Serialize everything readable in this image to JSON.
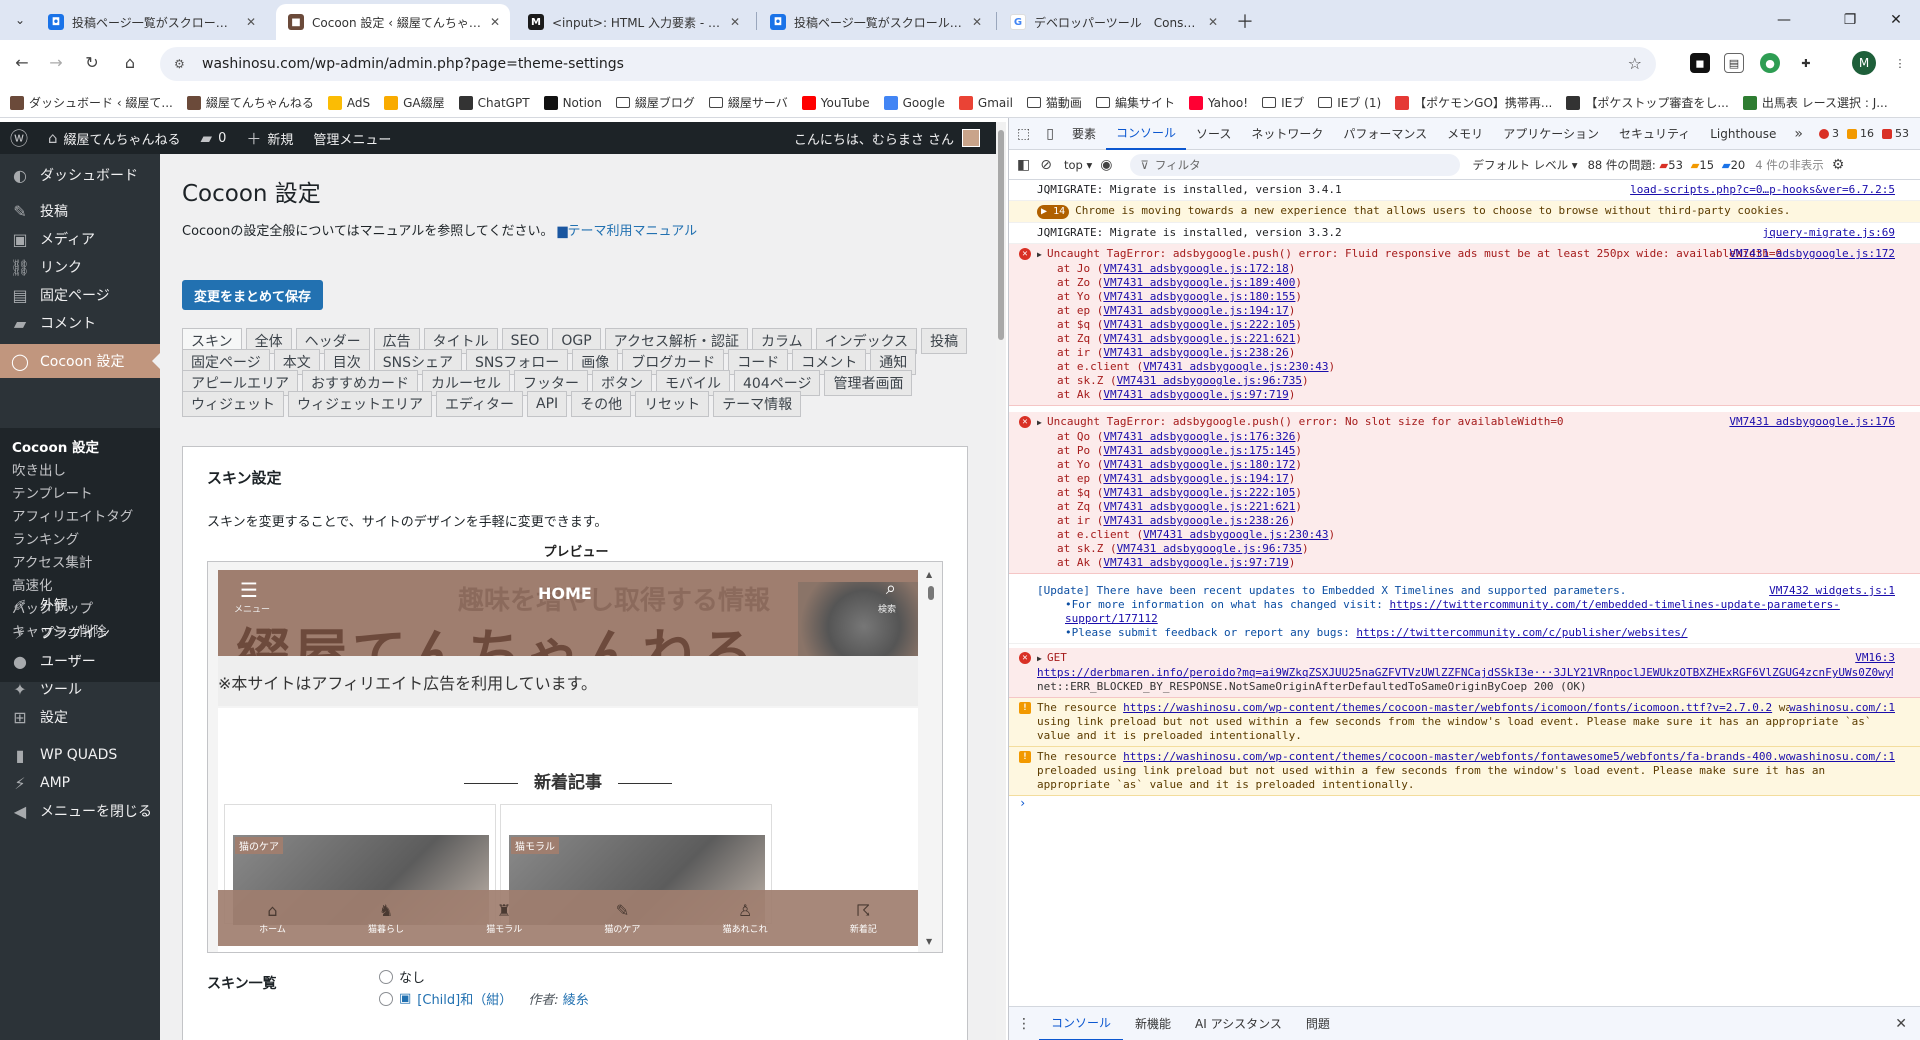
{
  "browser": {
    "tabs": [
      {
        "title": "投稿ページ一覧がスクロール出来な",
        "fav_color": "#1a73e8",
        "fav": "◘"
      },
      {
        "title": "Cocoon 設定 ‹ 綴屋てんちゃんねる",
        "fav_color": "#6b4a3a",
        "fav": "■"
      },
      {
        "title": "<input>: HTML 入力要素 - HTM",
        "fav_color": "#1b1b1b",
        "fav": "M"
      },
      {
        "title": "投稿ページ一覧がスクロール出来な",
        "fav_color": "#1a73e8",
        "fav": "◘"
      },
      {
        "title": "デベロッパーツール　Console - Goo",
        "fav_color": "#ffffff",
        "fav": "G"
      }
    ],
    "url": "washinosu.com/wp-admin/admin.php?page=theme-settings",
    "bookmarks": [
      {
        "label": "ダッシュボード ‹ 綴屋て...",
        "kind": "site",
        "color": "#6b4a3a"
      },
      {
        "label": "綴屋てんちゃんねる",
        "kind": "site",
        "color": "#6b4a3a"
      },
      {
        "label": "AdS",
        "kind": "site",
        "color": "#fbbc04"
      },
      {
        "label": "GA綴屋",
        "kind": "site",
        "color": "#f9ab00"
      },
      {
        "label": "ChatGPT",
        "kind": "site",
        "color": "#333333"
      },
      {
        "label": "Notion",
        "kind": "site",
        "color": "#111111"
      },
      {
        "label": "綴屋ブログ",
        "kind": "folder",
        "color": "#444444"
      },
      {
        "label": "綴屋サーバ",
        "kind": "folder",
        "color": "#444444"
      },
      {
        "label": "YouTube",
        "kind": "site",
        "color": "#ff0000"
      },
      {
        "label": "Google",
        "kind": "site",
        "color": "#4285f4"
      },
      {
        "label": "Gmail",
        "kind": "site",
        "color": "#ea4335"
      },
      {
        "label": "猫動画",
        "kind": "folder",
        "color": "#444444"
      },
      {
        "label": "編集サイト",
        "kind": "folder",
        "color": "#444444"
      },
      {
        "label": "Yahoo!",
        "kind": "site",
        "color": "#ff0033"
      },
      {
        "label": "IEブ",
        "kind": "folder",
        "color": "#444444"
      },
      {
        "label": "IEブ (1)",
        "kind": "folder",
        "color": "#444444"
      },
      {
        "label": "【ポケモンGO】携帯再...",
        "kind": "site",
        "color": "#e53935"
      },
      {
        "label": "【ポケストップ審査をし...",
        "kind": "site",
        "color": "#333333"
      },
      {
        "label": "出馬表 レース選択 : J...",
        "kind": "site",
        "color": "#2e7d32"
      }
    ],
    "profile_initial": "M"
  },
  "wp": {
    "adminbar": {
      "site_name": "綴屋てんちゃんねる",
      "comments_count": "0",
      "new_label": "新規",
      "admin_menu": "管理メニュー",
      "greeting": "こんにちは、むらまさ さん"
    },
    "sidebar": {
      "items": [
        {
          "label": "ダッシュボード",
          "icon": "dashboard-icon",
          "glyph": "◐"
        },
        {
          "label": "投稿",
          "icon": "pin-icon",
          "glyph": "✎"
        },
        {
          "label": "メディア",
          "icon": "media-icon",
          "glyph": "▣"
        },
        {
          "label": "リンク",
          "icon": "link-icon",
          "glyph": "⛓"
        },
        {
          "label": "固定ページ",
          "icon": "page-icon",
          "glyph": "▤"
        },
        {
          "label": "コメント",
          "icon": "comment-icon",
          "glyph": "▰"
        },
        {
          "label": "Cocoon 設定",
          "icon": "cocoon-icon",
          "glyph": "◯"
        },
        {
          "label": "外観",
          "icon": "appearance-icon",
          "glyph": "✐"
        },
        {
          "label": "プラグイン",
          "icon": "plugin-icon",
          "glyph": "⚡"
        },
        {
          "label": "ユーザー",
          "icon": "user-icon",
          "glyph": "●"
        },
        {
          "label": "ツール",
          "icon": "tool-icon",
          "glyph": "✦"
        },
        {
          "label": "設定",
          "icon": "settings-icon",
          "glyph": "⊞"
        },
        {
          "label": "WP QUADS",
          "icon": "quads-icon",
          "glyph": "▮"
        },
        {
          "label": "AMP",
          "icon": "amp-icon",
          "glyph": "⚡"
        },
        {
          "label": "メニューを閉じる",
          "icon": "collapse-icon",
          "glyph": "◀"
        }
      ],
      "submenu": [
        "Cocoon 設定",
        "吹き出し",
        "テンプレート",
        "アフィリエイトタグ",
        "ランキング",
        "アクセス集計",
        "高速化",
        "バックアップ",
        "キャッシュ削除"
      ]
    },
    "page": {
      "title": "Cocoon 設定",
      "intro": "Cocoonの設定全般についてはマニュアルを参照してください。",
      "manual_link": "テーマ利用マニュアル",
      "save_button": "変更をまとめて保存",
      "tab_rows": [
        [
          "スキン",
          "全体",
          "ヘッダー",
          "広告",
          "タイトル",
          "SEO",
          "OGP",
          "アクセス解析・認証",
          "カラム",
          "インデックス",
          "投稿"
        ],
        [
          "固定ページ",
          "本文",
          "目次",
          "SNSシェア",
          "SNSフォロー",
          "画像",
          "ブログカード",
          "コード",
          "コメント",
          "通知"
        ],
        [
          "アピールエリア",
          "おすすめカード",
          "カルーセル",
          "フッター",
          "ボタン",
          "モバイル",
          "404ページ",
          "管理者画面"
        ],
        [
          "ウィジェット",
          "ウィジェットエリア",
          "エディター",
          "API",
          "その他",
          "リセット",
          "テーマ情報"
        ]
      ],
      "panel_heading": "スキン設定",
      "panel_desc": "スキンを変更することで、サイトのデザインを手軽に変更できます。",
      "preview_label": "プレビュー",
      "preview": {
        "home": "HOME",
        "menu": "メニュー",
        "search": "検索",
        "header_big": "綴屋てんちゃんねる",
        "header_faint": "趣味を増やし取得する情報",
        "notice": "※本サイトはアフィリエイト広告を利用しています。",
        "newest": "新着記事",
        "card1_label": "猫のケア",
        "card2_label": "猫モラル",
        "footer": [
          {
            "label": "ホーム",
            "glyph": "⌂"
          },
          {
            "label": "猫暮らし",
            "glyph": "♞"
          },
          {
            "label": "猫モラル",
            "glyph": "♜"
          },
          {
            "label": "猫のケア",
            "glyph": "✎"
          },
          {
            "label": "猫あれこれ",
            "glyph": "♙"
          },
          {
            "label": "新着記",
            "glyph": "☈"
          }
        ]
      },
      "skin_list_heading": "スキン一覧",
      "skin_options": [
        {
          "label": "なし",
          "link": "",
          "author_prefix": "",
          "author": ""
        },
        {
          "label": "",
          "link": "[Child]和（紺）",
          "author_prefix": "作者:",
          "author": "綾糸"
        }
      ]
    }
  },
  "devtools": {
    "tabs": [
      "要素",
      "コンソール",
      "ソース",
      "ネットワーク",
      "パフォーマンス",
      "メモリ",
      "アプリケーション",
      "セキュリティ",
      "Lighthouse"
    ],
    "counts": {
      "errors": "3",
      "warnings": "16",
      "messages": "53"
    },
    "filterbar": {
      "context": "top",
      "filter_placeholder": "フィルタ",
      "level": "デフォルト レベル",
      "issues_label": "88 件の問題:",
      "issue_errors": "53",
      "issue_warnings": "15",
      "issue_info": "20",
      "hidden": "4 件の非表示"
    },
    "logs": {
      "l1": {
        "text": "JQMIGRATE: Migrate is installed, version 3.4.1",
        "src": "load-scripts.php?c=0…p-hooks&ver=6.7.2:5"
      },
      "l2": {
        "count": "14",
        "text": "Chrome is moving towards a new experience that allows users to choose to browse without third-party cookies."
      },
      "l3": {
        "text": "JQMIGRATE: Migrate is installed, version 3.3.2",
        "src": "jquery-migrate.js:69"
      },
      "e1": {
        "text": "Uncaught TagError: adsbygoogle.push() error: Fluid responsive ads must be at least 250px wide: availableWidth=0",
        "src": "VM7431 adsbygoogle.js:172",
        "stack": [
          {
            "fn": "at Jo (",
            "loc": "VM7431 adsbygoogle.js:172:18"
          },
          {
            "fn": "at Zo (",
            "loc": "VM7431 adsbygoogle.js:189:400"
          },
          {
            "fn": "at Yo (",
            "loc": "VM7431 adsbygoogle.js:180:155"
          },
          {
            "fn": "at ep (",
            "loc": "VM7431 adsbygoogle.js:194:17"
          },
          {
            "fn": "at $q (",
            "loc": "VM7431 adsbygoogle.js:222:105"
          },
          {
            "fn": "at Zq (",
            "loc": "VM7431 adsbygoogle.js:221:621"
          },
          {
            "fn": "at ir (",
            "loc": "VM7431 adsbygoogle.js:238:26"
          },
          {
            "fn": "at e.client (",
            "loc": "VM7431 adsbygoogle.js:230:43"
          },
          {
            "fn": "at sk.Z (",
            "loc": "VM7431 adsbygoogle.js:96:735"
          },
          {
            "fn": "at Ak (",
            "loc": "VM7431 adsbygoogle.js:97:719"
          }
        ]
      },
      "e2": {
        "text": "Uncaught TagError: adsbygoogle.push() error: No slot size for availableWidth=0",
        "src": "VM7431 adsbygoogle.js:176",
        "stack": [
          {
            "fn": "at Qo (",
            "loc": "VM7431 adsbygoogle.js:176:326"
          },
          {
            "fn": "at Po (",
            "loc": "VM7431 adsbygoogle.js:175:145"
          },
          {
            "fn": "at Yo (",
            "loc": "VM7431 adsbygoogle.js:180:172"
          },
          {
            "fn": "at ep (",
            "loc": "VM7431 adsbygoogle.js:194:17"
          },
          {
            "fn": "at $q (",
            "loc": "VM7431 adsbygoogle.js:222:105"
          },
          {
            "fn": "at Zq (",
            "loc": "VM7431 adsbygoogle.js:221:621"
          },
          {
            "fn": "at ir (",
            "loc": "VM7431 adsbygoogle.js:238:26"
          },
          {
            "fn": "at e.client (",
            "loc": "VM7431 adsbygoogle.js:230:43"
          },
          {
            "fn": "at sk.Z (",
            "loc": "VM7431 adsbygoogle.js:96:735"
          },
          {
            "fn": "at Ak (",
            "loc": "VM7431 adsbygoogle.js:97:719"
          }
        ]
      },
      "u1": {
        "text": "[Update] There have been recent updates to Embedded X Timelines and supported parameters.",
        "src": "VM7432 widgets.js:1",
        "line2_prefix": "•For more information on what has changed visit: ",
        "line2_link": "https://twittercommunity.com/t/embedded-timelines-update-parameters-support/177112",
        "line3_prefix": "•Please submit feedback or report any bugs: ",
        "line3_link": "https://twittercommunity.com/c/publisher/websites/"
      },
      "g1": {
        "text": "GET",
        "src": "VM16:3",
        "url": "https://derbmaren.info/peroido?mq=ai9WZkqZSXJUU25naGZFVTVzUWlZZFNCajdSSkI3e···3JLY21VRnpoclJEWUkzOTBXZHExRGF6VlZGUG4zcnFyUWs0Z0wyMzAzdzc3alJQS···",
        "err": "net::ERR_BLOCKED_BY_RESPONSE.NotSameOriginAfterDefaultedToSameOriginByCoep 200 (OK)"
      },
      "w1": {
        "prefix": "The resource ",
        "link": "https://washinosu.com/wp-content/themes/cocoon-master/webfonts/icomoon/fonts/icomoon.ttf?v=2.7.0.2",
        "suffix": " was preloaded using link preload but not used within a few seconds from the window's load event. Please make sure it has an appropriate `as` value and it is preloaded intentionally.",
        "src": "washinosu.com/:1"
      },
      "w2": {
        "prefix": "The resource ",
        "link": "https://washinosu.com/wp-content/themes/cocoon-master/webfonts/fontawesome5/webfonts/fa-brands-400.woff2",
        "suffix": " was preloaded using link preload but not used within a few seconds from the window's load event. Please make sure it has an appropriate `as` value and it is preloaded intentionally.",
        "src": "washinosu.com/:1"
      }
    },
    "drawer_tabs": [
      "コンソール",
      "新機能",
      "AI アシスタンス",
      "問題"
    ]
  }
}
